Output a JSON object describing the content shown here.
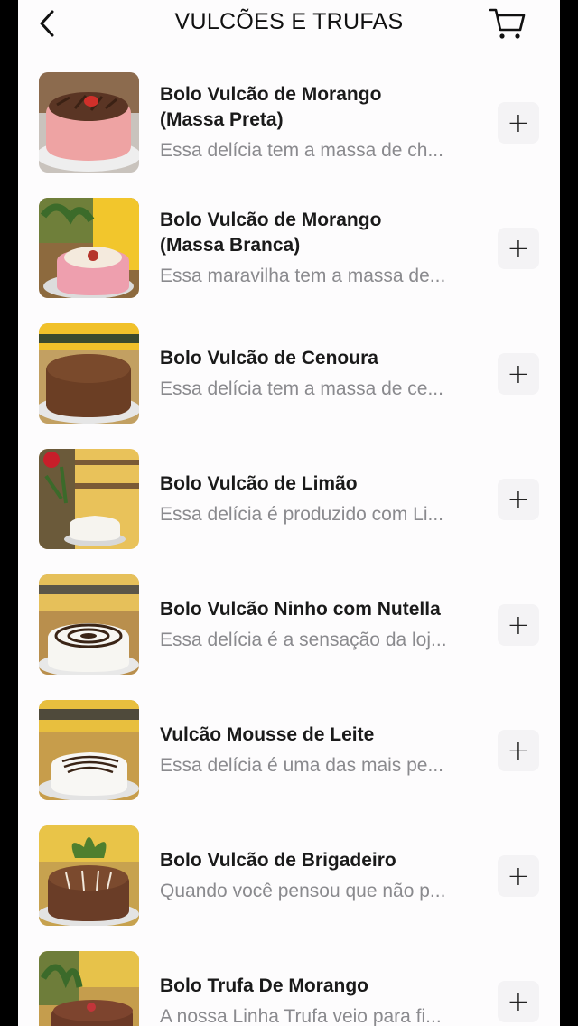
{
  "header": {
    "title": "VULCÕES E TRUFAS",
    "back_icon": "chevron-left-icon",
    "cart_icon": "cart-icon"
  },
  "products": [
    {
      "name_line1": "Bolo Vulcão de Morango",
      "name_line2": "(Massa Preta)",
      "desc": "Essa delícia tem a massa de ch...",
      "add": "+"
    },
    {
      "name_line1": "Bolo Vulcão de Morango",
      "name_line2": "(Massa Branca)",
      "desc": "Essa maravilha tem a massa de...",
      "add": "+"
    },
    {
      "name_line1": "Bolo Vulcão de Cenoura",
      "name_line2": "",
      "desc": "Essa delícia tem a massa de ce...",
      "add": "+"
    },
    {
      "name_line1": "Bolo Vulcão de Limão",
      "name_line2": "",
      "desc": "Essa delícia é produzido com Li...",
      "add": "+"
    },
    {
      "name_line1": "Bolo Vulcão Ninho com Nutella",
      "name_line2": "",
      "desc": "Essa delícia é a sensação da loj...",
      "add": "+"
    },
    {
      "name_line1": "Vulcão Mousse de Leite",
      "name_line2": "",
      "desc": "Essa delícia é uma das mais pe...",
      "add": "+"
    },
    {
      "name_line1": "Bolo Vulcão de Brigadeiro",
      "name_line2": "",
      "desc": "Quando você pensou que não p...",
      "add": "+"
    },
    {
      "name_line1": "Bolo Trufa De Morango",
      "name_line2": "",
      "desc": "A nossa Linha Trufa veio para fi...",
      "add": "+"
    }
  ]
}
